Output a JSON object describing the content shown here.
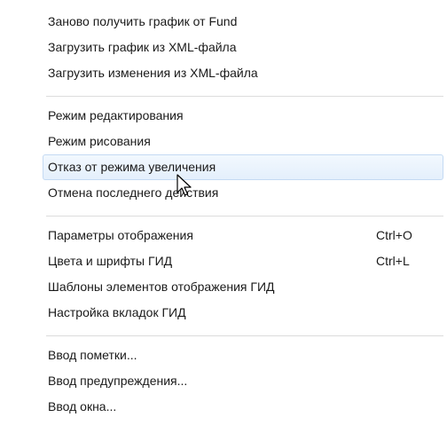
{
  "menu": {
    "groups": [
      {
        "items": [
          {
            "label": "Заново получить график от Fund",
            "shortcut": ""
          },
          {
            "label": "Загрузить график из XML-файла",
            "shortcut": ""
          },
          {
            "label": "Загрузить изменения из XML-файла",
            "shortcut": ""
          }
        ]
      },
      {
        "items": [
          {
            "label": "Режим редактирования",
            "shortcut": ""
          },
          {
            "label": "Режим рисования",
            "shortcut": ""
          },
          {
            "label": "Отказ от режима увеличения",
            "shortcut": "",
            "highlighted": true
          },
          {
            "label": "Отмена последнего действия",
            "shortcut": ""
          }
        ]
      },
      {
        "items": [
          {
            "label": "Параметры отображения",
            "shortcut": "Ctrl+O"
          },
          {
            "label": "Цвета и шрифты ГИД",
            "shortcut": "Ctrl+L"
          },
          {
            "label": "Шаблоны элементов отображения ГИД",
            "shortcut": ""
          },
          {
            "label": "Настройка вкладок ГИД",
            "shortcut": ""
          }
        ]
      },
      {
        "items": [
          {
            "label": "Ввод пометки...",
            "shortcut": ""
          },
          {
            "label": "Ввод предупреждения...",
            "shortcut": ""
          },
          {
            "label": "Ввод окна...",
            "shortcut": ""
          }
        ]
      }
    ]
  },
  "colors": {
    "highlight_border": "#c4daf3",
    "highlight_fill": "#e4effc",
    "separator": "#dcdcdc",
    "text": "#1a1a1a"
  },
  "cursor_icon": "arrow-cursor-icon"
}
